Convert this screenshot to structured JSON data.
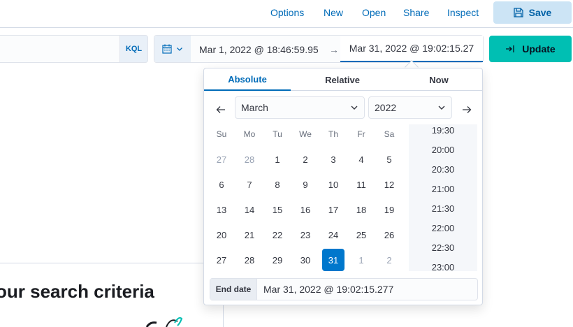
{
  "topnav": {
    "items": [
      "Options",
      "New",
      "Open",
      "Share",
      "Inspect"
    ],
    "save_label": "Save"
  },
  "query": {
    "language_label": "KQL"
  },
  "date_range": {
    "start": "Mar 1, 2022 @ 18:46:59.95",
    "end": "Mar 31, 2022 @ 19:02:15.27",
    "update_label": "Update"
  },
  "popover": {
    "tabs": [
      "Absolute",
      "Relative",
      "Now"
    ],
    "active_tab": "Absolute",
    "month": "March",
    "year": "2022",
    "weekdays": [
      "Su",
      "Mo",
      "Tu",
      "We",
      "Th",
      "Fr",
      "Sa"
    ],
    "weeks": [
      [
        "27",
        "28",
        "1",
        "2",
        "3",
        "4",
        "5"
      ],
      [
        "6",
        "7",
        "8",
        "9",
        "10",
        "11",
        "12"
      ],
      [
        "13",
        "14",
        "15",
        "16",
        "17",
        "18",
        "19"
      ],
      [
        "20",
        "21",
        "22",
        "23",
        "24",
        "25",
        "26"
      ],
      [
        "27",
        "28",
        "29",
        "30",
        "31",
        "1",
        "2"
      ]
    ],
    "selected_day": "31",
    "times": [
      "19:30",
      "20:00",
      "20:30",
      "21:00",
      "21:30",
      "22:00",
      "22:30",
      "23:00"
    ],
    "end_date_label": "End date",
    "end_date_value": "Mar 31, 2022 @ 19:02:15.277"
  },
  "background": {
    "empty_title": "our search criteria"
  },
  "colors": {
    "accent": "#006bb8",
    "update_button": "#00bfb3",
    "selected_day": "#0077cc"
  }
}
